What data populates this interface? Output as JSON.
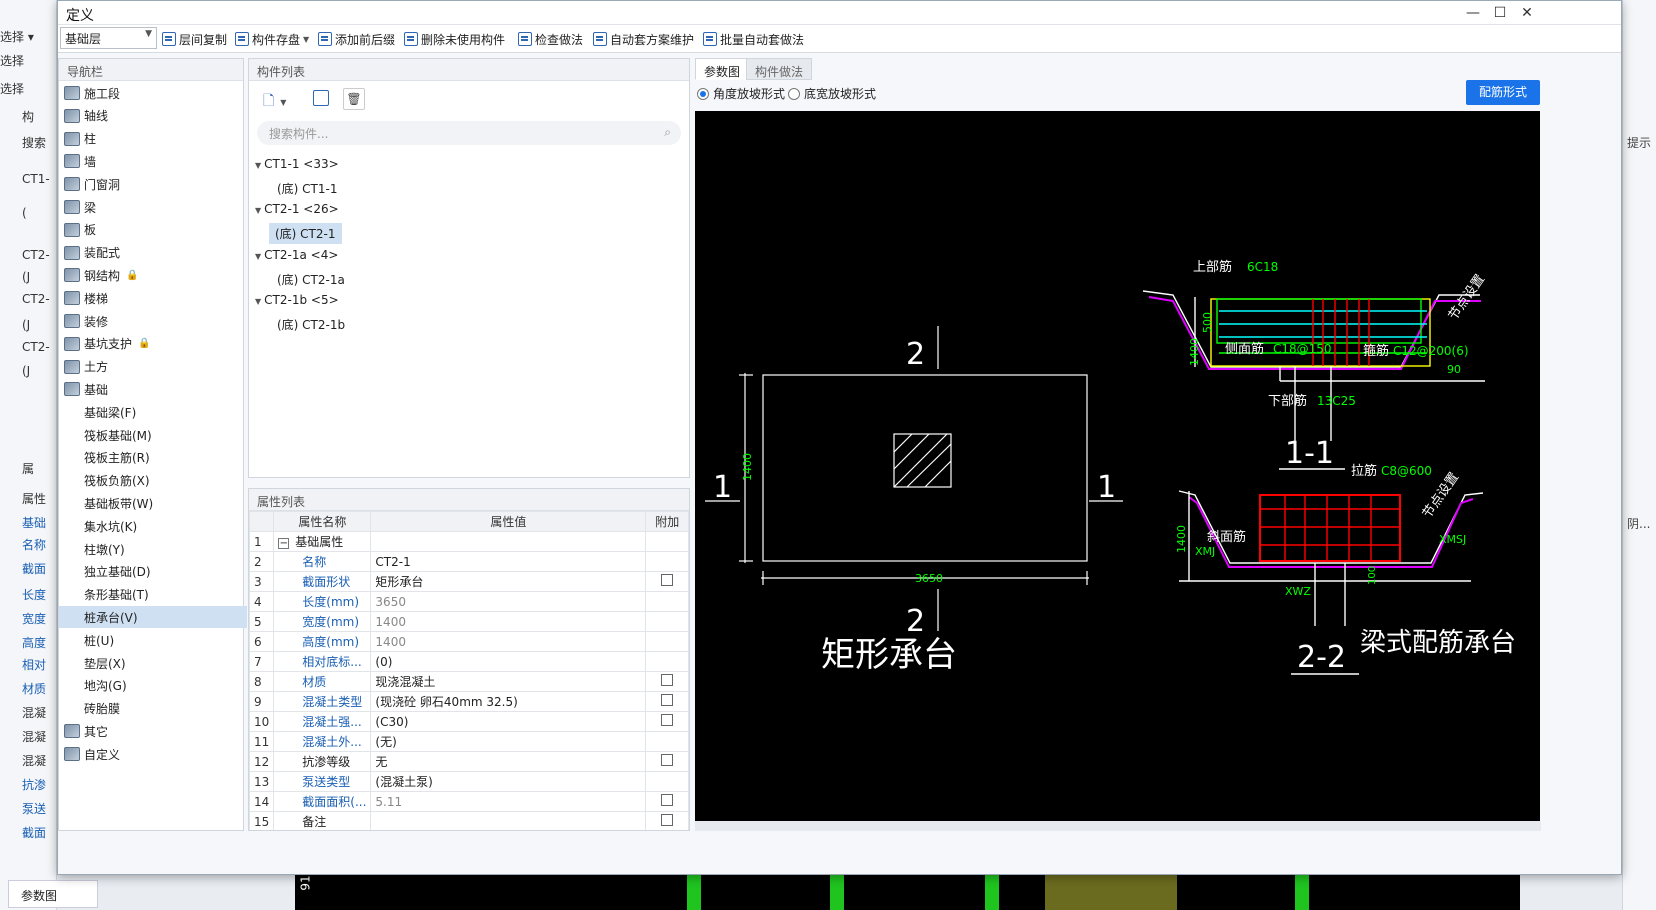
{
  "background": {
    "left_labels": [
      "选择 ▾",
      "选择",
      "选择",
      "构",
      "搜索",
      "CT1-",
      "(",
      "CT2-",
      "(J",
      "CT2-",
      "(J",
      "CT2-",
      "(J",
      "属",
      "属性",
      "基础",
      "名称",
      "截面",
      "长度",
      "宽度",
      "高度",
      "相对",
      "材质",
      "混凝",
      "混凝",
      "混凝",
      "抗渗",
      "泵送",
      "截面"
    ],
    "right_labels": [
      "提示",
      "阴..."
    ],
    "bottom_tab": "参数图",
    "bottom_num": "91"
  },
  "dialog": {
    "title": "定义",
    "controls": [
      "—",
      "☐",
      "✕"
    ]
  },
  "toolbar": {
    "floor_select": "基础层",
    "buttons": [
      "层间复制",
      "构件存盘",
      "添加前后缀",
      "删除未使用构件",
      "检查做法",
      "自动套方案维护",
      "批量自动套做法"
    ]
  },
  "nav": {
    "header": "导航栏",
    "items": [
      {
        "label": "施工段",
        "icon": "segment-icon"
      },
      {
        "label": "轴线",
        "icon": "axis-icon"
      },
      {
        "label": "柱",
        "icon": "column-icon"
      },
      {
        "label": "墙",
        "icon": "wall-icon"
      },
      {
        "label": "门窗洞",
        "icon": "door-window-icon"
      },
      {
        "label": "梁",
        "icon": "beam-icon"
      },
      {
        "label": "板",
        "icon": "slab-icon"
      },
      {
        "label": "装配式",
        "icon": "prefab-icon"
      },
      {
        "label": "钢结构",
        "icon": "steel-icon",
        "lock": "🔒"
      },
      {
        "label": "楼梯",
        "icon": "stairs-icon"
      },
      {
        "label": "装修",
        "icon": "decoration-icon"
      },
      {
        "label": "基坑支护",
        "icon": "pit-support-icon",
        "lock": "🔒"
      },
      {
        "label": "土方",
        "icon": "earthwork-icon"
      },
      {
        "label": "基础",
        "icon": "foundation-icon"
      }
    ],
    "sub_items": [
      "基础梁(F)",
      "筏板基础(M)",
      "筏板主筋(R)",
      "筏板负筋(X)",
      "基础板带(W)",
      "集水坑(K)",
      "柱墩(Y)",
      "独立基础(D)",
      "条形基础(T)",
      "桩承台(V)",
      "桩(U)",
      "垫层(X)",
      "地沟(G)",
      "砖胎膜"
    ],
    "selected_sub": 9,
    "tail_items": [
      {
        "label": "其它",
        "icon": "other-icon"
      },
      {
        "label": "自定义",
        "icon": "custom-icon"
      }
    ]
  },
  "component_list": {
    "header": "构件列表",
    "search_placeholder": "搜索构件...",
    "tree": [
      {
        "label": "CT1-1 <33>",
        "child": "(底) CT1-1"
      },
      {
        "label": "CT2-1 <26>",
        "child": "(底) CT2-1"
      },
      {
        "label": "CT2-1a <4>",
        "child": "(底) CT2-1a"
      },
      {
        "label": "CT2-1b <5>",
        "child": "(底) CT2-1b"
      }
    ],
    "selected": "(底) CT2-1"
  },
  "properties": {
    "header": "属性列表",
    "columns": [
      "属性名称",
      "属性值",
      "附加"
    ],
    "rows": [
      {
        "n": "1",
        "name": "基础属性",
        "value": "",
        "group": true
      },
      {
        "n": "2",
        "name": "名称",
        "value": "CT2-1",
        "blue": true,
        "grey": false,
        "cb": false
      },
      {
        "n": "3",
        "name": "截面形状",
        "value": "矩形承台",
        "blue": true,
        "grey": false,
        "cb": true
      },
      {
        "n": "4",
        "name": "长度(mm)",
        "value": "3650",
        "blue": true,
        "grey": true,
        "cb": false
      },
      {
        "n": "5",
        "name": "宽度(mm)",
        "value": "1400",
        "blue": true,
        "grey": true,
        "cb": false
      },
      {
        "n": "6",
        "name": "高度(mm)",
        "value": "1400",
        "blue": true,
        "grey": true,
        "cb": false
      },
      {
        "n": "7",
        "name": "相对底标...",
        "value": "(0)",
        "blue": true,
        "grey": false,
        "cb": false
      },
      {
        "n": "8",
        "name": "材质",
        "value": "现浇混凝土",
        "blue": true,
        "grey": false,
        "cb": true
      },
      {
        "n": "9",
        "name": "混凝土类型",
        "value": "(现浇砼 卵石40mm 32.5)",
        "blue": true,
        "grey": false,
        "cb": true
      },
      {
        "n": "10",
        "name": "混凝土强...",
        "value": "(C30)",
        "blue": true,
        "grey": false,
        "cb": true
      },
      {
        "n": "11",
        "name": "混凝土外...",
        "value": "(无)",
        "blue": true,
        "grey": false,
        "cb": false
      },
      {
        "n": "12",
        "name": "抗渗等级",
        "value": "无",
        "blue": false,
        "grey": false,
        "cb": true
      },
      {
        "n": "13",
        "name": "泵送类型",
        "value": "(混凝土泵)",
        "blue": true,
        "grey": false,
        "cb": false
      },
      {
        "n": "14",
        "name": "截面面积(...",
        "value": "5.11",
        "blue": true,
        "grey": true,
        "cb": true
      },
      {
        "n": "15",
        "name": "备注",
        "value": "",
        "blue": false,
        "grey": false,
        "cb": true
      }
    ]
  },
  "right": {
    "tabs": [
      "参数图",
      "构件做法"
    ],
    "radio_1": "角度放坡形式",
    "radio_2": "底宽放坡形式",
    "button": "配筋形式"
  },
  "drawing": {
    "plan_title": "矩形承台",
    "plan_dim_length": "3650",
    "plan_dim_width": "1400",
    "sec_label_2": "2",
    "sec_label_1": "1",
    "s11_top": "上部筋",
    "s11_top_val": "6C18",
    "s11_side": "侧面筋",
    "s11_side_val": "C18@150",
    "s11_stir": "箍筋",
    "s11_stir_val": "C12@200(6)",
    "s11_bot": "下部筋",
    "s11_bot_val": "13C25",
    "s11_node": "节点设置",
    "s11_h1": "500",
    "s11_h2": "1400",
    "s11_angle": "90",
    "s11_title": "1-1",
    "s22_tie": "拉筋",
    "s22_tie_val": "C8@600",
    "s22_slope": "斜面筋",
    "s22_xmj": "XMJ",
    "s22_xmsj": "XMSJ",
    "s22_xwz": "XWZ",
    "s22_h": "1400",
    "s22_h2": "100",
    "s22_node": "节点设置",
    "s22_title": "2-2",
    "beam_title": "梁式配筋承台"
  }
}
